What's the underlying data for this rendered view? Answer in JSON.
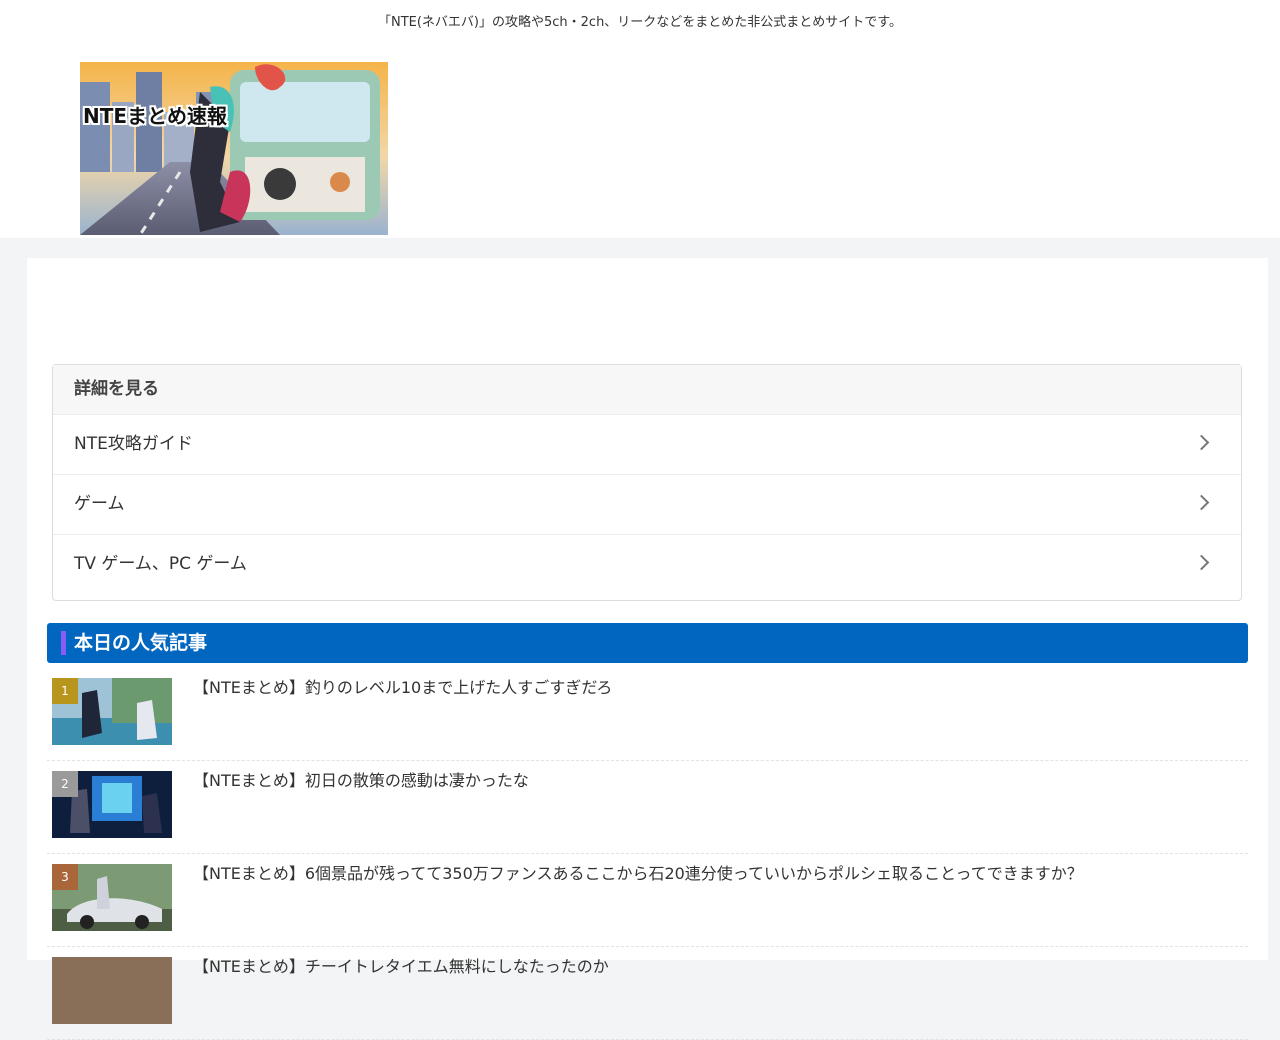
{
  "header": {
    "tagline": "「NTE(ネバエバ)」の攻略や5ch・2ch、リークなどをまとめた非公式まとめサイトです。",
    "logo_text": "NTEまとめ速報"
  },
  "details": {
    "title": "詳細を見る",
    "items": [
      {
        "label": "NTE攻略ガイド"
      },
      {
        "label": "ゲーム"
      },
      {
        "label": "TV ゲーム、PC ゲーム"
      }
    ]
  },
  "ranking": {
    "title": "本日の人気記事",
    "items": [
      {
        "rank": "1",
        "title": "【NTEまとめ】釣りのレベル10まで上げた人すごすぎだろ",
        "badge_color": "#b8961e"
      },
      {
        "rank": "2",
        "title": "【NTEまとめ】初日の散策の感動は凄かったな",
        "badge_color": "#9a9a9a"
      },
      {
        "rank": "3",
        "title": "【NTEまとめ】6個景品が残ってて350万ファンスあるここから石20連分使っていいからポルシェ取ることってできますか？",
        "badge_color": "#a8663a"
      },
      {
        "rank": "",
        "title": "【NTEまとめ】チーイトレタイエム無料にしなたったのか",
        "badge_color": "#777777"
      }
    ]
  },
  "colors": {
    "accent": "#0066c0",
    "accent_bar": "#8a5cf5",
    "page_bg": "#f3f4f5"
  }
}
